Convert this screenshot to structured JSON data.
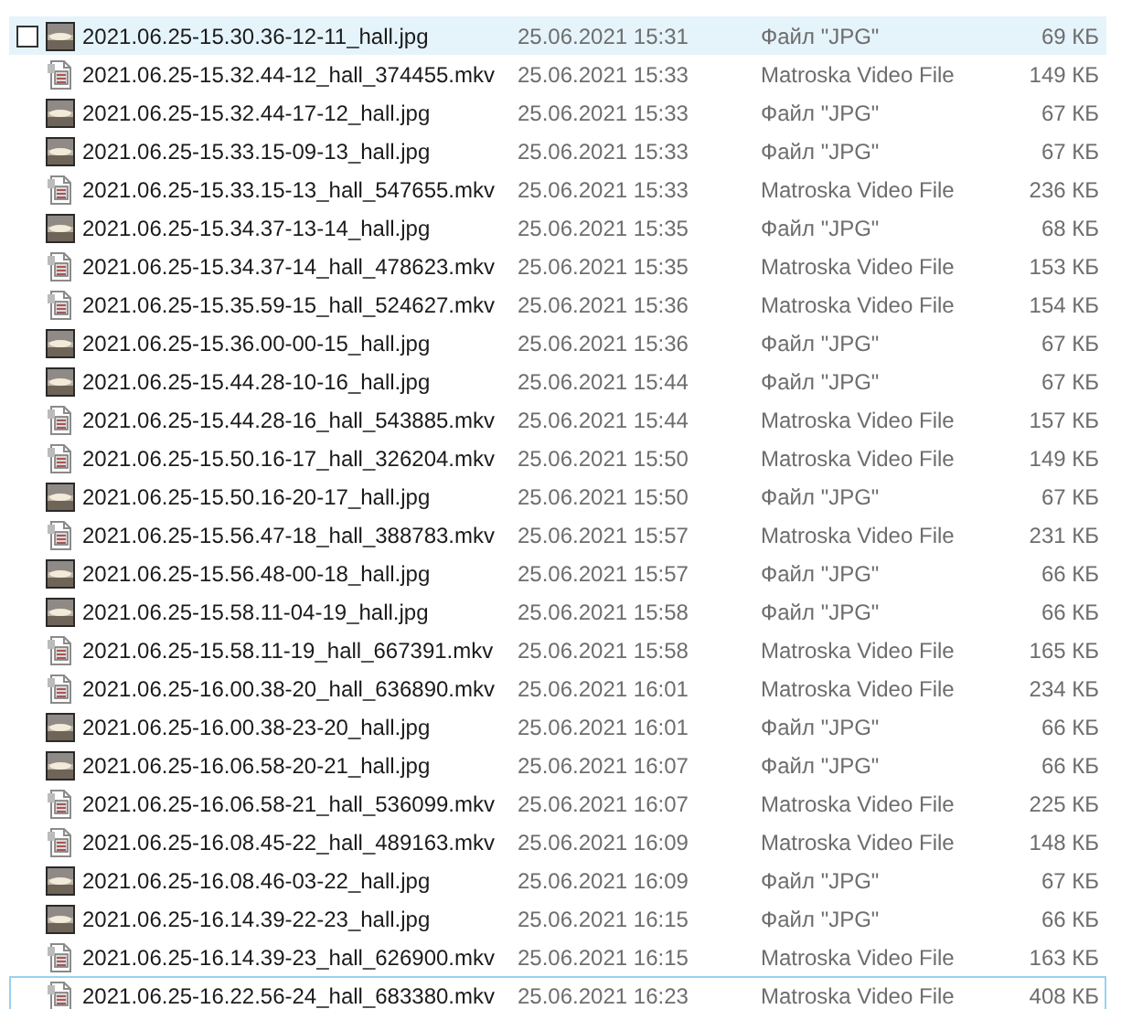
{
  "rows": [
    {
      "kind": "image",
      "name": "2021.06.25-15.30.36-12-11_hall.jpg",
      "date": "25.06.2021 15:31",
      "type": "Файл \"JPG\"",
      "size": "69 КБ",
      "hovered": true,
      "focused": false
    },
    {
      "kind": "video",
      "name": "2021.06.25-15.32.44-12_hall_374455.mkv",
      "date": "25.06.2021 15:33",
      "type": "Matroska Video File",
      "size": "149 КБ",
      "hovered": false,
      "focused": false
    },
    {
      "kind": "image",
      "name": "2021.06.25-15.32.44-17-12_hall.jpg",
      "date": "25.06.2021 15:33",
      "type": "Файл \"JPG\"",
      "size": "67 КБ",
      "hovered": false,
      "focused": false
    },
    {
      "kind": "image",
      "name": "2021.06.25-15.33.15-09-13_hall.jpg",
      "date": "25.06.2021 15:33",
      "type": "Файл \"JPG\"",
      "size": "67 КБ",
      "hovered": false,
      "focused": false
    },
    {
      "kind": "video",
      "name": "2021.06.25-15.33.15-13_hall_547655.mkv",
      "date": "25.06.2021 15:33",
      "type": "Matroska Video File",
      "size": "236 КБ",
      "hovered": false,
      "focused": false
    },
    {
      "kind": "image",
      "name": "2021.06.25-15.34.37-13-14_hall.jpg",
      "date": "25.06.2021 15:35",
      "type": "Файл \"JPG\"",
      "size": "68 КБ",
      "hovered": false,
      "focused": false
    },
    {
      "kind": "video",
      "name": "2021.06.25-15.34.37-14_hall_478623.mkv",
      "date": "25.06.2021 15:35",
      "type": "Matroska Video File",
      "size": "153 КБ",
      "hovered": false,
      "focused": false
    },
    {
      "kind": "video",
      "name": "2021.06.25-15.35.59-15_hall_524627.mkv",
      "date": "25.06.2021 15:36",
      "type": "Matroska Video File",
      "size": "154 КБ",
      "hovered": false,
      "focused": false
    },
    {
      "kind": "image",
      "name": "2021.06.25-15.36.00-00-15_hall.jpg",
      "date": "25.06.2021 15:36",
      "type": "Файл \"JPG\"",
      "size": "67 КБ",
      "hovered": false,
      "focused": false
    },
    {
      "kind": "image",
      "name": "2021.06.25-15.44.28-10-16_hall.jpg",
      "date": "25.06.2021 15:44",
      "type": "Файл \"JPG\"",
      "size": "67 КБ",
      "hovered": false,
      "focused": false
    },
    {
      "kind": "video",
      "name": "2021.06.25-15.44.28-16_hall_543885.mkv",
      "date": "25.06.2021 15:44",
      "type": "Matroska Video File",
      "size": "157 КБ",
      "hovered": false,
      "focused": false
    },
    {
      "kind": "video",
      "name": "2021.06.25-15.50.16-17_hall_326204.mkv",
      "date": "25.06.2021 15:50",
      "type": "Matroska Video File",
      "size": "149 КБ",
      "hovered": false,
      "focused": false
    },
    {
      "kind": "image",
      "name": "2021.06.25-15.50.16-20-17_hall.jpg",
      "date": "25.06.2021 15:50",
      "type": "Файл \"JPG\"",
      "size": "67 КБ",
      "hovered": false,
      "focused": false
    },
    {
      "kind": "video",
      "name": "2021.06.25-15.56.47-18_hall_388783.mkv",
      "date": "25.06.2021 15:57",
      "type": "Matroska Video File",
      "size": "231 КБ",
      "hovered": false,
      "focused": false
    },
    {
      "kind": "image",
      "name": "2021.06.25-15.56.48-00-18_hall.jpg",
      "date": "25.06.2021 15:57",
      "type": "Файл \"JPG\"",
      "size": "66 КБ",
      "hovered": false,
      "focused": false
    },
    {
      "kind": "image",
      "name": "2021.06.25-15.58.11-04-19_hall.jpg",
      "date": "25.06.2021 15:58",
      "type": "Файл \"JPG\"",
      "size": "66 КБ",
      "hovered": false,
      "focused": false
    },
    {
      "kind": "video",
      "name": "2021.06.25-15.58.11-19_hall_667391.mkv",
      "date": "25.06.2021 15:58",
      "type": "Matroska Video File",
      "size": "165 КБ",
      "hovered": false,
      "focused": false
    },
    {
      "kind": "video",
      "name": "2021.06.25-16.00.38-20_hall_636890.mkv",
      "date": "25.06.2021 16:01",
      "type": "Matroska Video File",
      "size": "234 КБ",
      "hovered": false,
      "focused": false
    },
    {
      "kind": "image",
      "name": "2021.06.25-16.00.38-23-20_hall.jpg",
      "date": "25.06.2021 16:01",
      "type": "Файл \"JPG\"",
      "size": "66 КБ",
      "hovered": false,
      "focused": false
    },
    {
      "kind": "image",
      "name": "2021.06.25-16.06.58-20-21_hall.jpg",
      "date": "25.06.2021 16:07",
      "type": "Файл \"JPG\"",
      "size": "66 КБ",
      "hovered": false,
      "focused": false
    },
    {
      "kind": "video",
      "name": "2021.06.25-16.06.58-21_hall_536099.mkv",
      "date": "25.06.2021 16:07",
      "type": "Matroska Video File",
      "size": "225 КБ",
      "hovered": false,
      "focused": false
    },
    {
      "kind": "video",
      "name": "2021.06.25-16.08.45-22_hall_489163.mkv",
      "date": "25.06.2021 16:09",
      "type": "Matroska Video File",
      "size": "148 КБ",
      "hovered": false,
      "focused": false
    },
    {
      "kind": "image",
      "name": "2021.06.25-16.08.46-03-22_hall.jpg",
      "date": "25.06.2021 16:09",
      "type": "Файл \"JPG\"",
      "size": "67 КБ",
      "hovered": false,
      "focused": false
    },
    {
      "kind": "image",
      "name": "2021.06.25-16.14.39-22-23_hall.jpg",
      "date": "25.06.2021 16:15",
      "type": "Файл \"JPG\"",
      "size": "66 КБ",
      "hovered": false,
      "focused": false
    },
    {
      "kind": "video",
      "name": "2021.06.25-16.14.39-23_hall_626900.mkv",
      "date": "25.06.2021 16:15",
      "type": "Matroska Video File",
      "size": "163 КБ",
      "hovered": false,
      "focused": false
    },
    {
      "kind": "video",
      "name": "2021.06.25-16.22.56-24_hall_683380.mkv",
      "date": "25.06.2021 16:23",
      "type": "Matroska Video File",
      "size": "408 КБ",
      "hovered": false,
      "focused": true
    }
  ]
}
